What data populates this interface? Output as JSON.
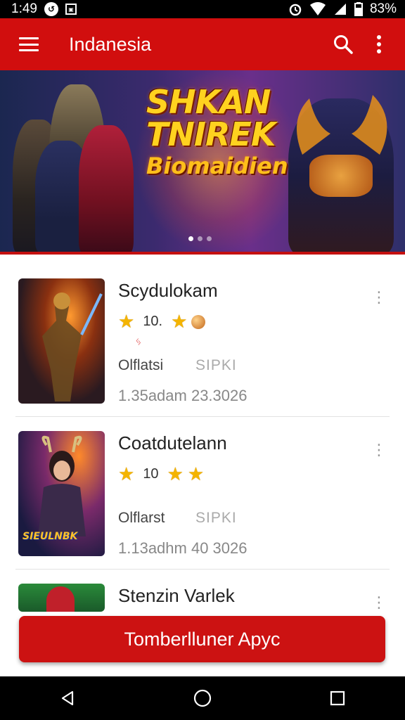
{
  "status_bar": {
    "time": "1:49",
    "battery": "83%"
  },
  "app_bar": {
    "title": "Indanesia"
  },
  "banner": {
    "title_line1": "SHKAN",
    "title_line2": "TNIREK",
    "title_line3": "Biomaidien",
    "page_indicator": {
      "total": 3,
      "active": 1
    }
  },
  "apps": [
    {
      "title": "Scydulokam",
      "rating_text": "10.",
      "flag": "ᛃ",
      "subtitle": "Olflatsi",
      "badge": "SIPKI",
      "meta": "1.35adam  23.3026"
    },
    {
      "title": "Coatdutelann",
      "rating_text": "10",
      "subtitle": "Olflarst",
      "badge": "SIPKI",
      "meta": "1.13adhm  40 3026",
      "thumb_text": "SIEULNBK"
    },
    {
      "title": "Stenzin Varlek"
    }
  ],
  "install_button": {
    "label": "Tomberlluner Apyc"
  },
  "colors": {
    "primary": "#d10e0e",
    "star": "#f4b400"
  },
  "icons": {
    "menu": "hamburger-icon",
    "search": "search-icon",
    "more": "more-vert-icon",
    "back": "back-icon",
    "home": "home-icon",
    "recents": "recents-icon"
  }
}
